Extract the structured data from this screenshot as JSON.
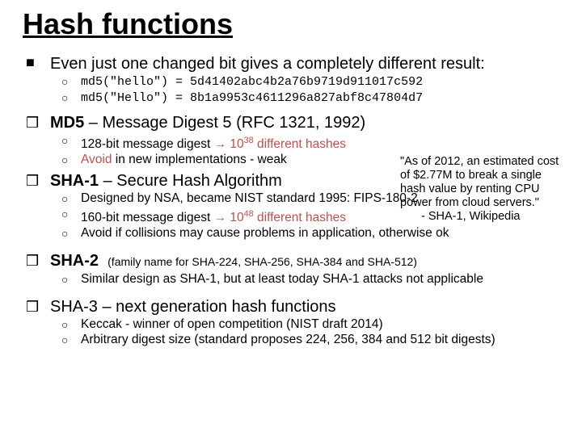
{
  "title": "Hash functions",
  "intro": {
    "headline": "Even just one changed bit gives a completely different result:",
    "ex1": "md5(\"hello\") = 5d41402abc4b2a76b9719d911017c592",
    "ex2": "md5(\"Hello\") = 8b1a9953c4611296a827abf8c47804d7"
  },
  "md5": {
    "head_name": "MD5",
    "head_rest": " – Message Digest 5 (RFC 1321, 1992)",
    "p1_a": "128-bit message digest ",
    "p1_arrow": "→",
    "p1_base": " 10",
    "p1_exp": "38",
    "p1_b": " different hashes",
    "p2_a": "Avoid",
    "p2_b": " in new implementations - weak"
  },
  "sha1": {
    "head_name": "SHA-1",
    "head_rest": " – Secure Hash Algorithm",
    "p1": "Designed by NSA, became NIST standard 1995: FIPS-180-2",
    "p2_a": "160-bit message digest ",
    "p2_arrow": "→",
    "p2_base": " 10",
    "p2_exp": "48",
    "p2_b": " different hashes",
    "p3": "Avoid if collisions may cause problems in application, otherwise ok"
  },
  "sha2": {
    "head_name": "SHA-2",
    "head_note": "(family name for SHA-224, SHA-256, SHA-384 and SHA-512)",
    "p1": "Similar design as SHA-1, but at least today SHA-1 attacks not applicable"
  },
  "sha3": {
    "head": "SHA-3 – next generation hash functions",
    "p1": "Keccak - winner of open competition (NIST draft 2014)",
    "p2": "Arbitrary digest size (standard proposes 224, 256, 384 and 512 bit digests)"
  },
  "quote": {
    "body": "\"As of 2012, an estimated cost of $2.77M to break a single hash value by renting CPU power from cloud servers.\"",
    "attr": "- SHA-1, Wikipedia"
  }
}
